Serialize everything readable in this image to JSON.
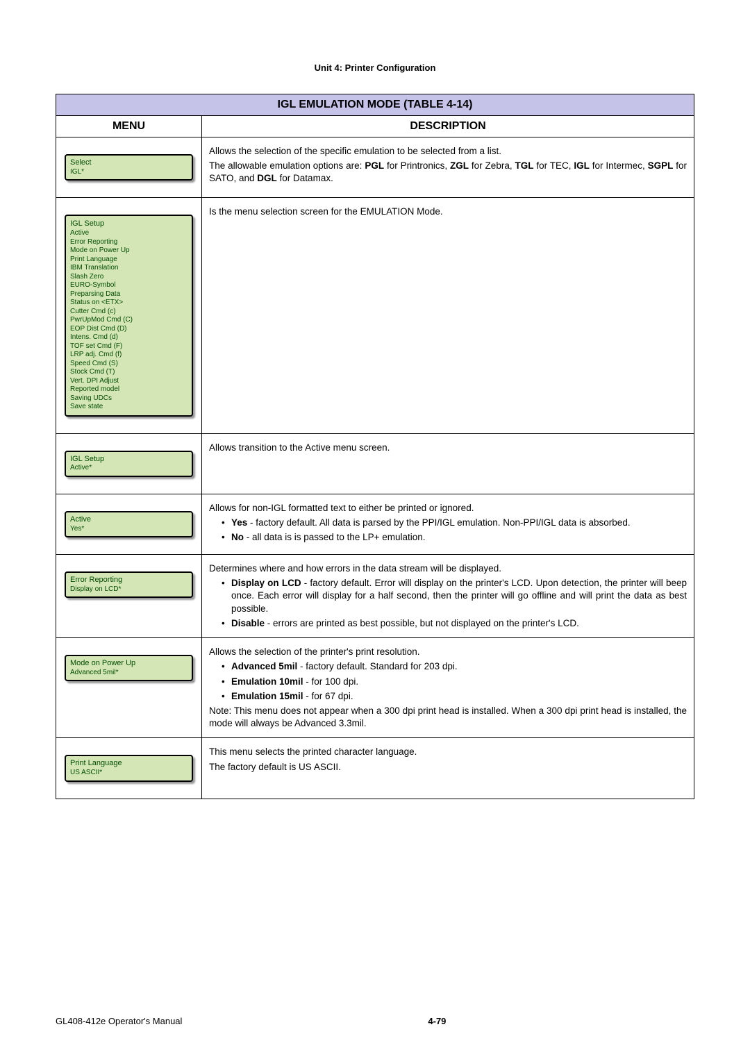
{
  "unit_header": "Unit 4:  Printer Configuration",
  "table_title": "IGL EMULATION MODE (TABLE 4-14)",
  "col_menu": "MENU",
  "col_desc": "DESCRIPTION",
  "rows": {
    "select": {
      "lcd_title": "Select",
      "lcd_value": "IGL*",
      "p1": "Allows the selection of the specific emulation to be selected from a list.",
      "p2a": "The allowable emulation options are: ",
      "p2b": "PGL",
      "p2c": " for Printronics, ",
      "p2d": "ZGL",
      "p2e": " for Zebra, ",
      "p2f": "TGL",
      "p2g": " for TEC, ",
      "p2h": "IGL",
      "p2i": " for Intermec, ",
      "p2j": "SGPL",
      "p2k": " for SATO, and ",
      "p2l": "DGL",
      "p2m": " for Datamax."
    },
    "iglsetup": {
      "lcd_title": "IGL Setup",
      "items": [
        "Active",
        "Error Reporting",
        "Mode on Power Up",
        "Print Language",
        "IBM Translation",
        "Slash Zero",
        "EURO-Symbol",
        "Preparsing Data",
        "Status on <ETX>",
        "Cutter Cmd (c)",
        "PwrUpMod Cmd (C)",
        "EOP Dist Cmd (D)",
        "Intens. Cmd (d)",
        "TOF set Cmd (F)",
        "LRP adj. Cmd (f)",
        "Speed Cmd (S)",
        "Stock Cmd (T)",
        "Vert. DPI Adjust",
        "Reported model",
        "Saving UDCs",
        "Save state"
      ],
      "p1": "Is the menu selection screen for the EMULATION Mode."
    },
    "active_transition": {
      "lcd_title": "IGL Setup",
      "lcd_value": "Active*",
      "p1": "Allows transition to the Active menu screen."
    },
    "active": {
      "lcd_title": "Active",
      "lcd_value": "Yes*",
      "p1": "Allows for non-IGL formatted text to either be printed or ignored.",
      "b1a": "Yes",
      "b1b": " - factory default. All data is parsed by the PPI/IGL emulation. Non-PPI/IGL data is absorbed.",
      "b2a": "No",
      "b2b": " - all data is is passed to the LP+ emulation."
    },
    "error": {
      "lcd_title": "Error Reporting",
      "lcd_value": "Display on LCD*",
      "p1": "Determines where and how errors in the data stream will be displayed.",
      "b1a": "Display on LCD",
      "b1b": " - factory default. Error will display on the printer's LCD. Upon detection, the printer will beep once. Each error will display for a half second, then the printer will go offline and will print the data as best possible.",
      "b2a": "Disable",
      "b2b": " - errors are printed as best possible, but not displayed on the printer's LCD."
    },
    "mode": {
      "lcd_title": "Mode on Power Up",
      "lcd_value": "Advanced 5mil*",
      "p1": "Allows the selection of the printer's print resolution.",
      "b1a": "Advanced 5mil",
      "b1b": " - factory default. Standard for 203 dpi.",
      "b2a": "Emulation 10mil",
      "b2b": " - for 100 dpi.",
      "b3a": "Emulation 15mil",
      "b3b": " - for 67 dpi.",
      "note": "Note: This menu does not appear when a 300 dpi print head is installed. When a 300 dpi print head is installed, the mode will always be Advanced 3.3mil."
    },
    "lang": {
      "lcd_title": "Print Language",
      "lcd_value": "US ASCII*",
      "p1": "This menu selects the printed character language.",
      "p2": "The factory default is US ASCII."
    }
  },
  "footer_left": "GL408-412e Operator's Manual",
  "footer_page": "4-79"
}
